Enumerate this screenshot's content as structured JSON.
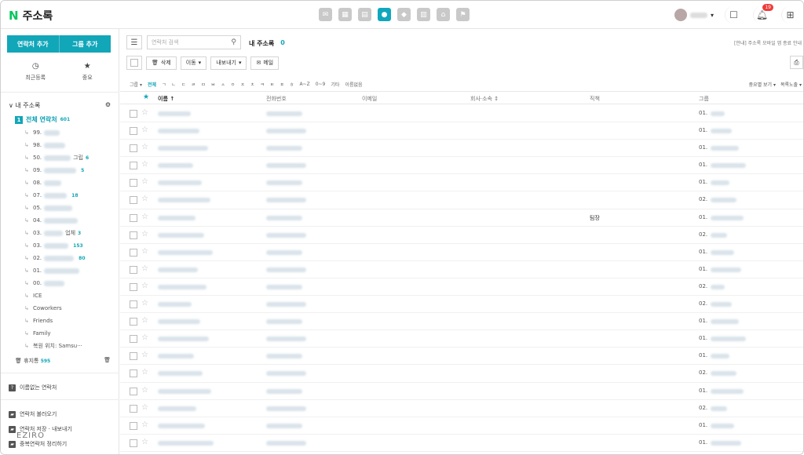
{
  "app": {
    "brand_letter": "N",
    "title": "주소록"
  },
  "topbar": {
    "apps": [
      "mail-icon",
      "calendar-icon",
      "memo-icon",
      "contacts-icon",
      "cafe-icon",
      "drive-icon",
      "home-icon",
      "bookmark-icon"
    ],
    "notification_count": "19",
    "avatar_dropdown": "▾"
  },
  "sidebar": {
    "add_contact_label": "연락처 추가",
    "add_group_label": "그룹 추가",
    "recent_label": "최근등록",
    "important_label": "중요",
    "book_title": "내 주소록",
    "all_contacts_label": "전체 연락처",
    "all_contacts_count": "601",
    "groups": [
      {
        "prefix": "99.",
        "suffix": "",
        "count": ""
      },
      {
        "prefix": "98.",
        "suffix": "",
        "count": ""
      },
      {
        "prefix": "50.",
        "suffix": "그립",
        "count": "6"
      },
      {
        "prefix": "09.",
        "suffix": "",
        "count": "5"
      },
      {
        "prefix": "08.",
        "suffix": "",
        "count": ""
      },
      {
        "prefix": "07.",
        "suffix": "",
        "count": "18"
      },
      {
        "prefix": "05.",
        "suffix": "",
        "count": ""
      },
      {
        "prefix": "04.",
        "suffix": "",
        "count": ""
      },
      {
        "prefix": "03.",
        "suffix": "업체",
        "count": "3"
      },
      {
        "prefix": "03.",
        "suffix": "",
        "count": "153"
      },
      {
        "prefix": "02.",
        "suffix": "",
        "count": "80"
      },
      {
        "prefix": "01.",
        "suffix": "",
        "count": ""
      },
      {
        "prefix": "00.",
        "suffix": "",
        "count": ""
      },
      {
        "prefix": "ICE",
        "suffix": "",
        "count": ""
      },
      {
        "prefix": "Coworkers",
        "suffix": "",
        "count": ""
      },
      {
        "prefix": "Friends",
        "suffix": "",
        "count": ""
      },
      {
        "prefix": "Family",
        "suffix": "",
        "count": ""
      },
      {
        "prefix": "복원 위치: Samsu···",
        "suffix": "",
        "count": ""
      }
    ],
    "trash_label": "휴지통",
    "trash_count": "595",
    "unnamed_label": "이름없는 연락처",
    "import_label": "연락처 불러오기",
    "export_label": "연락처 저장 · 내보내기",
    "cleanup_label": "중복연락처 정리하기",
    "watermark": "EZIRO"
  },
  "main": {
    "search_placeholder": "연락처 검색",
    "book_title": "내 주소록",
    "book_count": "0",
    "notice": "[안내] 주소록 모바일 앱 종료 안내",
    "delete_label": "삭제",
    "move_label": "이동",
    "export_label": "내보내기",
    "mail_label": "메일",
    "filters": [
      "그룹 ▾",
      "전체",
      "ㄱ",
      "ㄴ",
      "ㄷ",
      "ㄹ",
      "ㅁ",
      "ㅂ",
      "ㅅ",
      "ㅇ",
      "ㅈ",
      "ㅊ",
      "ㅋ",
      "ㅌ",
      "ㅍ",
      "ㅎ",
      "A~Z",
      "0~9",
      "기타",
      "이름없음"
    ],
    "view_label": "중요별 보기 ▾",
    "sort_label": "목록노출 ▾",
    "columns": {
      "name": "이름 ↑",
      "phone": "전화번호",
      "email": "이메일",
      "company": "회사·소속 ↕",
      "position": "직책",
      "group": "그룹"
    },
    "rows": [
      {
        "position": "",
        "group": "01."
      },
      {
        "position": "",
        "group": "01."
      },
      {
        "position": "",
        "group": "01."
      },
      {
        "position": "",
        "group": "01."
      },
      {
        "position": "",
        "group": "01."
      },
      {
        "position": "",
        "group": "02."
      },
      {
        "position": "팀장",
        "group": "01."
      },
      {
        "position": "",
        "group": "02."
      },
      {
        "position": "",
        "group": "01."
      },
      {
        "position": "",
        "group": "01."
      },
      {
        "position": "",
        "group": "02."
      },
      {
        "position": "",
        "group": "02."
      },
      {
        "position": "",
        "group": "01."
      },
      {
        "position": "",
        "group": "01."
      },
      {
        "position": "",
        "group": "01."
      },
      {
        "position": "",
        "group": "02."
      },
      {
        "position": "",
        "group": "01."
      },
      {
        "position": "",
        "group": "02."
      },
      {
        "position": "",
        "group": "01."
      },
      {
        "position": "",
        "group": "01."
      },
      {
        "position": "",
        "group": "01."
      }
    ]
  }
}
